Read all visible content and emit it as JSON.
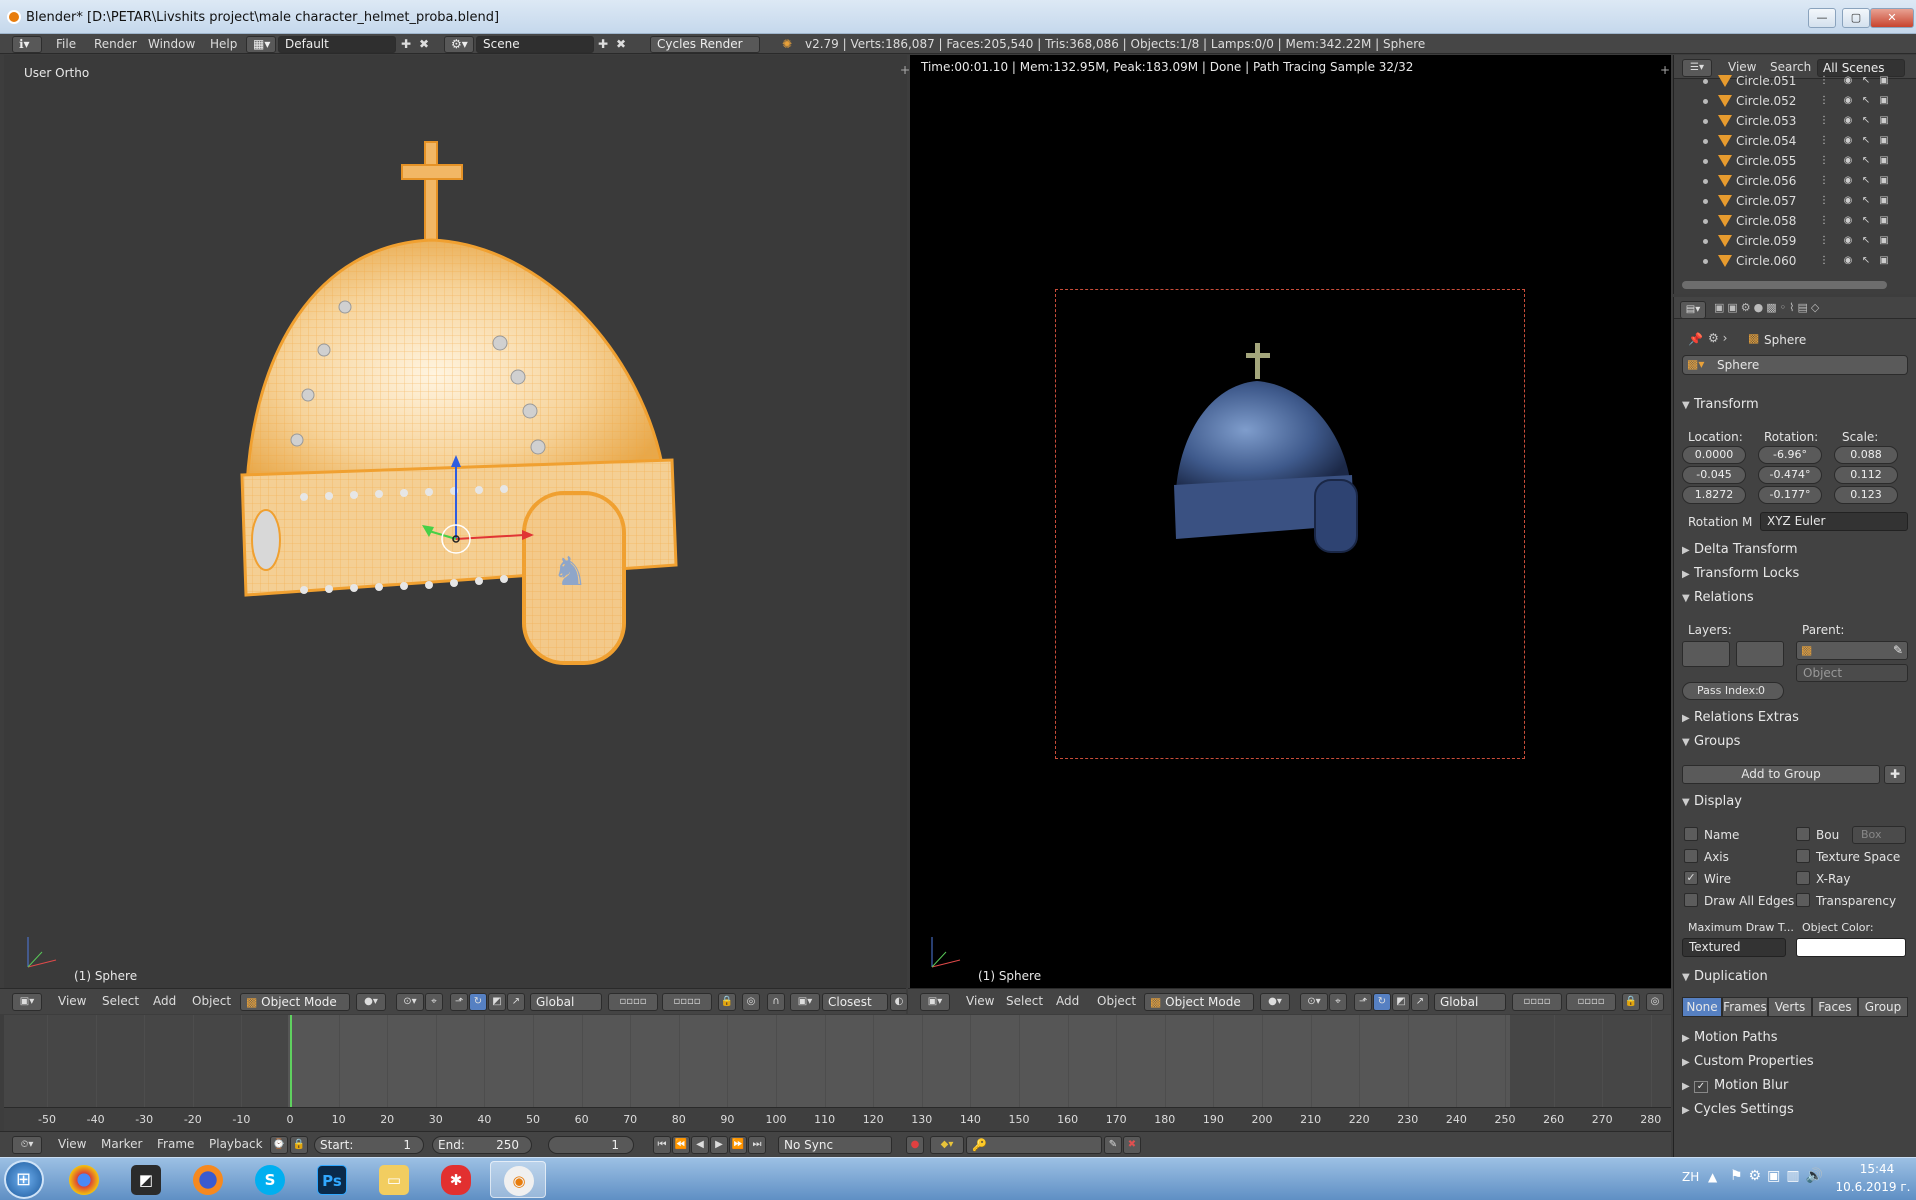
{
  "window": {
    "title": "Blender* [D:\\PETAR\\Livshits project\\male character_helmet_proba.blend]",
    "minimize": "—",
    "maximize": "▢",
    "close": "✕"
  },
  "infobar": {
    "menus": [
      "File",
      "Render",
      "Window",
      "Help"
    ],
    "layout": "Default",
    "scene": "Scene",
    "engine": "Cycles Render",
    "stats": "v2.79 | Verts:186,087 | Faces:205,540 | Tris:368,086 | Objects:1/8 | Lamps:0/0 | Mem:342.22M | Sphere"
  },
  "left_view": {
    "name": "User Ortho",
    "object": "(1) Sphere"
  },
  "right_view": {
    "render_status": "Time:00:01.10 | Mem:132.95M, Peak:183.09M | Done | Path Tracing Sample 32/32",
    "object": "(1) Sphere"
  },
  "view_header": {
    "menus": [
      "View",
      "Select",
      "Add",
      "Object"
    ],
    "mode": "Object Mode",
    "orientation": "Global",
    "snap": "Closest"
  },
  "timeline": {
    "ticks": [
      "-50",
      "-40",
      "-30",
      "-20",
      "-10",
      "0",
      "10",
      "20",
      "30",
      "40",
      "50",
      "60",
      "70",
      "80",
      "90",
      "100",
      "110",
      "120",
      "130",
      "140",
      "150",
      "160",
      "170",
      "180",
      "190",
      "200",
      "210",
      "220",
      "230",
      "240",
      "250",
      "260",
      "270",
      "280"
    ],
    "current_frame": 0
  },
  "playback": {
    "menus": [
      "View",
      "Marker",
      "Frame",
      "Playback"
    ],
    "start_label": "Start:",
    "start": "1",
    "end_label": "End:",
    "end": "250",
    "frame": "1",
    "sync": "No Sync"
  },
  "outliner": {
    "tabs": [
      "View",
      "Search",
      "All Scenes"
    ],
    "items": [
      "Circle.051",
      "Circle.052",
      "Circle.053",
      "Circle.054",
      "Circle.055",
      "Circle.056",
      "Circle.057",
      "Circle.058",
      "Circle.059",
      "Circle.060"
    ]
  },
  "properties": {
    "breadcrumb": "Sphere",
    "object_name": "Sphere",
    "transform_title": "Transform",
    "location_label": "Location:",
    "rotation_label": "Rotation:",
    "scale_label": "Scale:",
    "location": [
      "0.0000",
      "-0.045",
      "1.8272"
    ],
    "rotation": [
      "-6.96°",
      "-0.474°",
      "-0.177°"
    ],
    "scale": [
      "0.088",
      "0.112",
      "0.123"
    ],
    "rotation_mode_label": "Rotation M",
    "rotation_mode": "XYZ Euler",
    "delta_transform": "Delta Transform",
    "transform_locks": "Transform Locks",
    "relations": "Relations",
    "layers_label": "Layers:",
    "parent_label": "Parent:",
    "parent_type": "Object",
    "pass_index_label": "Pass Index:",
    "pass_index": "0",
    "relations_extras": "Relations Extras",
    "groups": "Groups",
    "add_to_group": "Add to Group",
    "display": "Display",
    "disp_name": "Name",
    "disp_bou": "Bou",
    "disp_box": "Box",
    "disp_axis": "Axis",
    "disp_texture_space": "Texture Space",
    "disp_wire": "Wire",
    "disp_xray": "X-Ray",
    "disp_all_edges": "Draw All Edges",
    "disp_transparency": "Transparency",
    "max_draw_label": "Maximum Draw T...",
    "object_color_label": "Object Color:",
    "max_draw": "Textured",
    "duplication": "Duplication",
    "dup_options": [
      "None",
      "Frames",
      "Verts",
      "Faces",
      "Group"
    ],
    "motion_paths": "Motion Paths",
    "custom_properties": "Custom Properties",
    "motion_blur": "Motion Blur",
    "cycles_settings": "Cycles Settings"
  },
  "taskbar": {
    "language": "ZH",
    "time": "15:44",
    "date": "10.6.2019 г."
  },
  "colors": {
    "blender_bg": "#3d3d3d",
    "selection_orange": "#f5a623",
    "render_border": "#c94d3a",
    "active_blue": "#5680c2"
  }
}
